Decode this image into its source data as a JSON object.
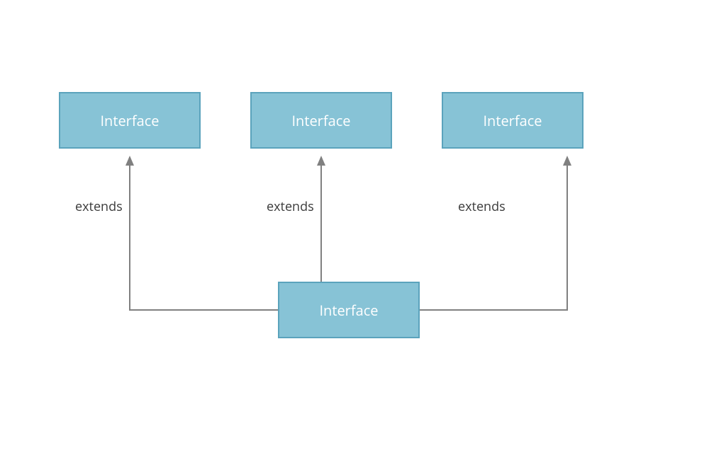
{
  "diagram": {
    "nodes": {
      "top_left": {
        "label": "Interface"
      },
      "top_center": {
        "label": "Interface"
      },
      "top_right": {
        "label": "Interface"
      },
      "bottom": {
        "label": "Interface"
      }
    },
    "edges": {
      "left": {
        "label": "extends"
      },
      "center": {
        "label": "extends"
      },
      "right": {
        "label": "extends"
      }
    },
    "colors": {
      "box_fill": "#87c3d6",
      "box_border": "#5ba3bc",
      "box_text": "#ffffff",
      "line": "#808080",
      "label_text": "#3a3a3a"
    }
  }
}
